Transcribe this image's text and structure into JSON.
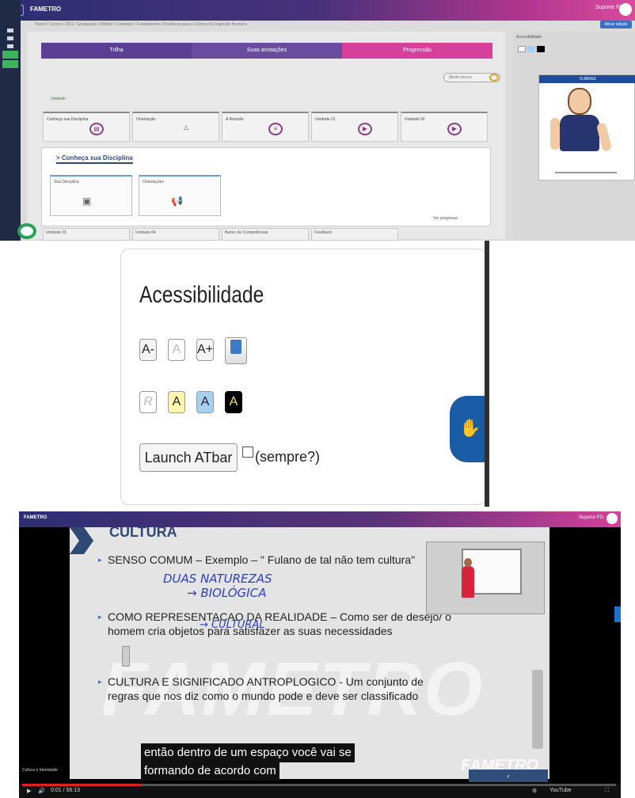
{
  "panel1": {
    "brand": "FAMETRO",
    "breadcrumb": "Painel / Cursos / 2023 / Graduação / Módulo / Conteúdo / Fundamentos Filosóficos para a Ciência da Cognição Humana",
    "user": "Suporte FG",
    "edit_button": "Ativar edição",
    "segments": [
      "Trilha",
      "Suas anotações",
      "Progressão"
    ],
    "toggle": "Modo escuro",
    "small_tag": "Unidade",
    "tabs": [
      {
        "label": "Conheça sua Disciplina"
      },
      {
        "label": "Orientação"
      },
      {
        "label": "A Revisão"
      },
      {
        "label": "Unidade 01"
      },
      {
        "label": "Unidade 02"
      }
    ],
    "section_title": "> Conheça sua Disciplina",
    "subcards": [
      {
        "label": "Sua Disciplina"
      },
      {
        "label": "Orientações"
      }
    ],
    "section_footer": "Ver progresso",
    "bottom_tabs": [
      "Unidade 03",
      "Unidade 04",
      "Banco de Competências",
      "Feedback"
    ],
    "right_panel_title": "Acessibilidade",
    "vlibras_title": "VLIBRAS"
  },
  "accessibility": {
    "title": "Acessibilidade",
    "font_buttons": [
      "A-",
      "A",
      "A+"
    ],
    "contrast_buttons": [
      "R",
      "A",
      "A",
      "A"
    ],
    "launch_label": "Launch ATbar",
    "checkbox_label": "(sempre?)",
    "colors": {
      "yellow": "#fff7b0",
      "blue": "#a7cff2",
      "black": "#000000",
      "vlibras": "#1a5ba6"
    }
  },
  "video": {
    "top_brand": "FAMETRO",
    "top_user": "Suporte FG",
    "slide_title": "CULTURA",
    "bullets": [
      "SENSO COMUM – Exemplo – \" Fulano de tal não tem cultura\"",
      "COMO REPRESENTACAO DA REALIDADE – Como ser de desejo/ o homem cria objetos para satisfazer as suas necessidades",
      "CULTURA E SIGNIFICADO ANTROPLOGICO - Um conjunto de regras que nos diz como o mundo pode e deve ser classificado"
    ],
    "handwriting": [
      "DUAS NATUREZAS",
      "→ BIOLÓGICA",
      "→ CULTURAL"
    ],
    "watermark": "FAMETRO",
    "subtitle_line1": "então dentro de um espaço você vai se",
    "subtitle_line2": "formando de acordo com",
    "progress": 0.2,
    "controls_left": "0:01 / 56:13",
    "controls_right": "YouTube",
    "left_caption": "Cultura e Identidade"
  }
}
